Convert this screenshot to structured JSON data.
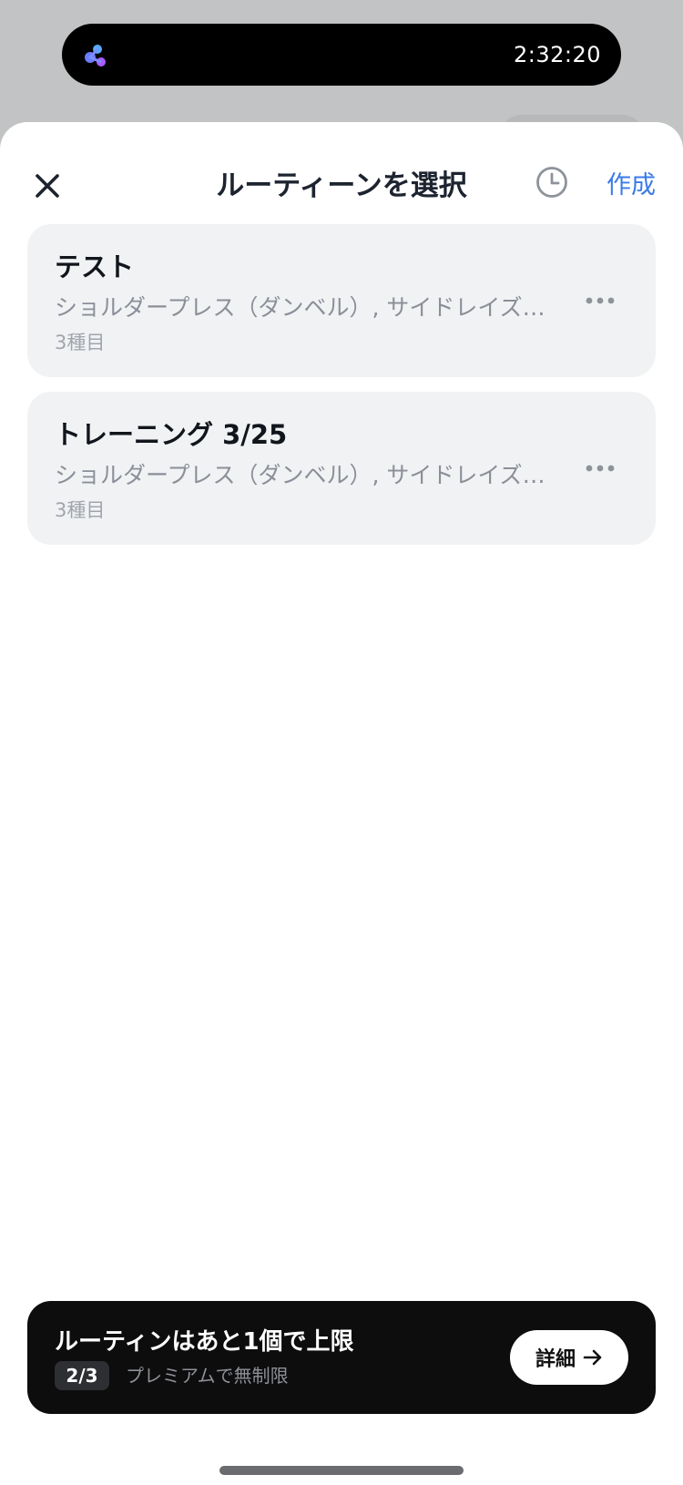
{
  "status_bar": {
    "time": "2:32:20",
    "app_icon": "app-logo-icon"
  },
  "header": {
    "close_icon": "close-icon",
    "title": "ルーティーンを選択",
    "history_icon": "clock-icon",
    "create_label": "作成"
  },
  "routines": [
    {
      "title": "テスト",
      "exercises": "ショルダープレス（ダンベル）, サイドレイズ（ダンベル）, ベンチプレス",
      "count": "3種目"
    },
    {
      "title": "トレーニング 3/25",
      "exercises": "ショルダープレス（ダンベル）, サイドレイズ（ダンベル）, ベンチプレス",
      "count": "3種目"
    }
  ],
  "limit_banner": {
    "title": "ルーティンはあと1個で上限",
    "badge": "2/3",
    "note": "プレミアムで無制限",
    "detail_label": "詳細",
    "detail_icon": "arrow-right-icon"
  },
  "colors": {
    "accent": "#3a7be8",
    "card_background": "#f1f2f4",
    "banner_background": "#0d0d0e"
  }
}
